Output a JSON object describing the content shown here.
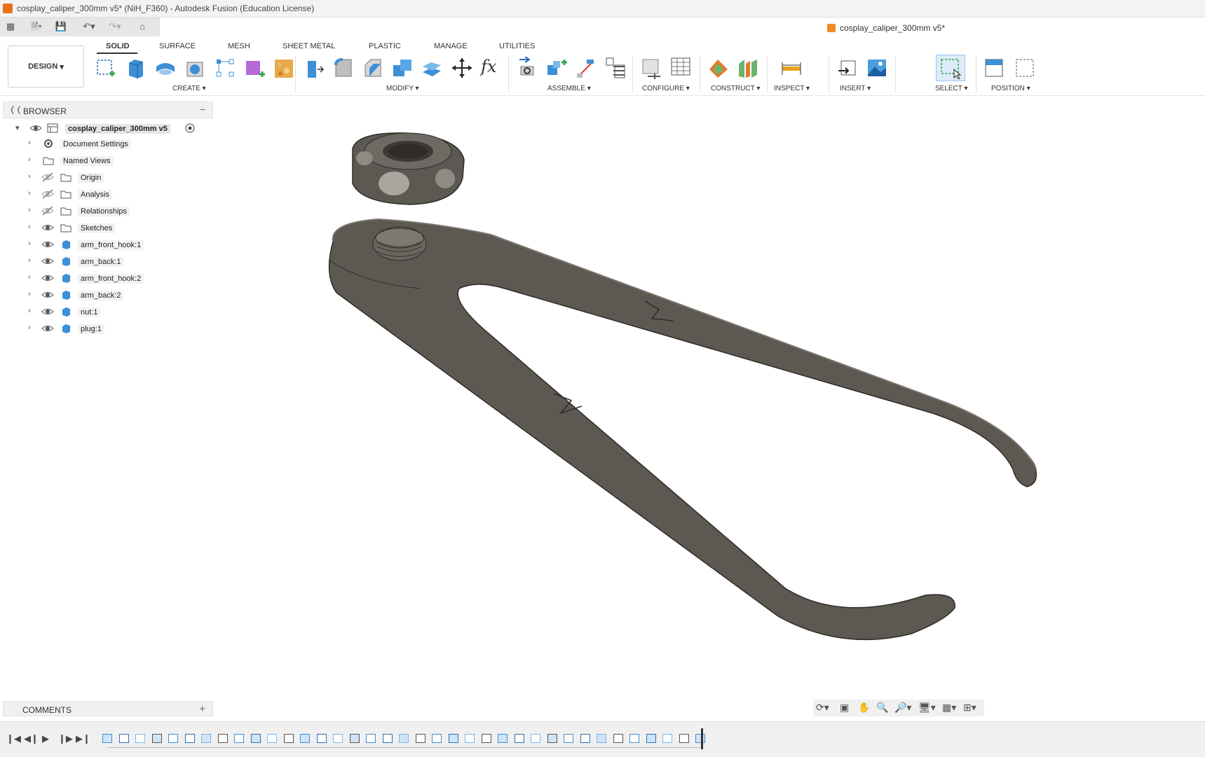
{
  "window": {
    "title": "cosplay_caliper_300mm v5* (NiH_F360) - Autodesk Fusion (Education License)"
  },
  "document_tab": {
    "title": "cosplay_caliper_300mm v5*"
  },
  "workspace": {
    "label": "DESIGN"
  },
  "tabs": [
    {
      "label": "SOLID"
    },
    {
      "label": "SURFACE"
    },
    {
      "label": "MESH"
    },
    {
      "label": "SHEET METAL"
    },
    {
      "label": "PLASTIC"
    },
    {
      "label": "MANAGE"
    },
    {
      "label": "UTILITIES"
    }
  ],
  "groups": {
    "create": "CREATE",
    "modify": "MODIFY",
    "assemble": "ASSEMBLE",
    "configure": "CONFIGURE",
    "construct": "CONSTRUCT",
    "inspect": "INSPECT",
    "insert": "INSERT",
    "select": "SELECT",
    "position": "POSITION"
  },
  "browser": {
    "title": "BROWSER",
    "root": "cosplay_caliper_300mm v5",
    "items": [
      {
        "label": "Document Settings",
        "icon": "gear-icon",
        "visibility": "none"
      },
      {
        "label": "Named Views",
        "icon": "folder-icon",
        "visibility": "none"
      },
      {
        "label": "Origin",
        "icon": "folder-icon",
        "visibility": "hidden"
      },
      {
        "label": "Analysis",
        "icon": "folder-icon",
        "visibility": "hidden"
      },
      {
        "label": "Relationships",
        "icon": "folder-icon",
        "visibility": "hidden"
      },
      {
        "label": "Sketches",
        "icon": "folder-icon",
        "visibility": "visible"
      },
      {
        "label": "arm_front_hook:1",
        "icon": "body-icon",
        "visibility": "visible"
      },
      {
        "label": "arm_back:1",
        "icon": "body-icon",
        "visibility": "visible"
      },
      {
        "label": "arm_front_hook:2",
        "icon": "body-icon",
        "visibility": "visible"
      },
      {
        "label": "arm_back:2",
        "icon": "body-icon",
        "visibility": "visible"
      },
      {
        "label": "nut:1",
        "icon": "body-icon",
        "visibility": "visible"
      },
      {
        "label": "plug:1",
        "icon": "body-icon",
        "visibility": "visible"
      }
    ]
  },
  "comments": {
    "title": "COMMENTS"
  },
  "colors": {
    "accent_orange": "#f08a24",
    "body_blue": "#3d8fd6",
    "model_fill": "#5d5952",
    "model_edge": "#2e2b27"
  }
}
